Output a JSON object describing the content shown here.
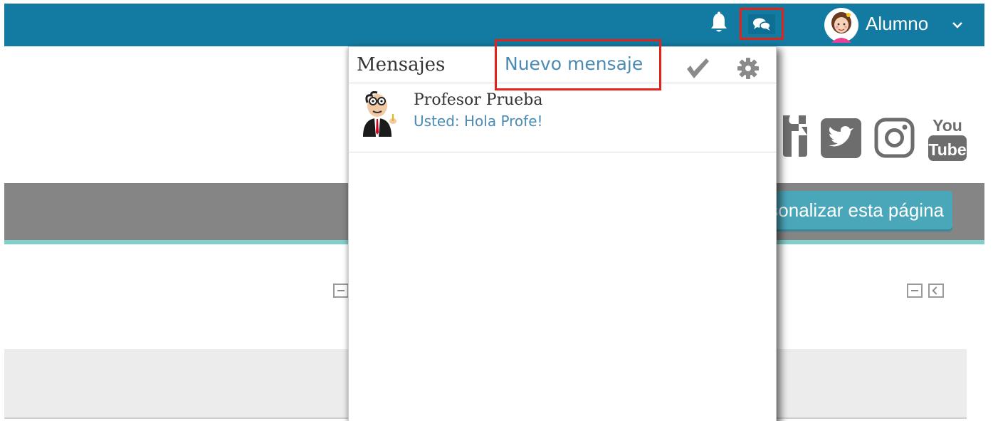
{
  "header": {
    "user_name": "Alumno",
    "icons": {
      "notifications": "bell-icon",
      "messages": "chat-bubbles-icon",
      "menu": "chevron-down-icon"
    }
  },
  "background": {
    "cta_label": "Personalizar esta página",
    "social_icons": [
      "facebook-icon",
      "twitter-icon",
      "instagram-icon",
      "youtube-icon"
    ],
    "youtube_text_top": "You",
    "youtube_text_bottom": "Tube"
  },
  "messages_popup": {
    "title": "Mensajes",
    "new_message_label": "Nuevo mensaje",
    "icons": {
      "mark_read": "check-icon",
      "settings": "gear-icon"
    },
    "threads": [
      {
        "sender": "Profesor Prueba",
        "preview": "Usted: Hola Profe!"
      }
    ]
  },
  "colors": {
    "navbar": "#137ba2",
    "highlight": "#e2231a",
    "link": "#4a8ab3",
    "gray_band": "#858585",
    "cta": "#4aa7ba"
  }
}
